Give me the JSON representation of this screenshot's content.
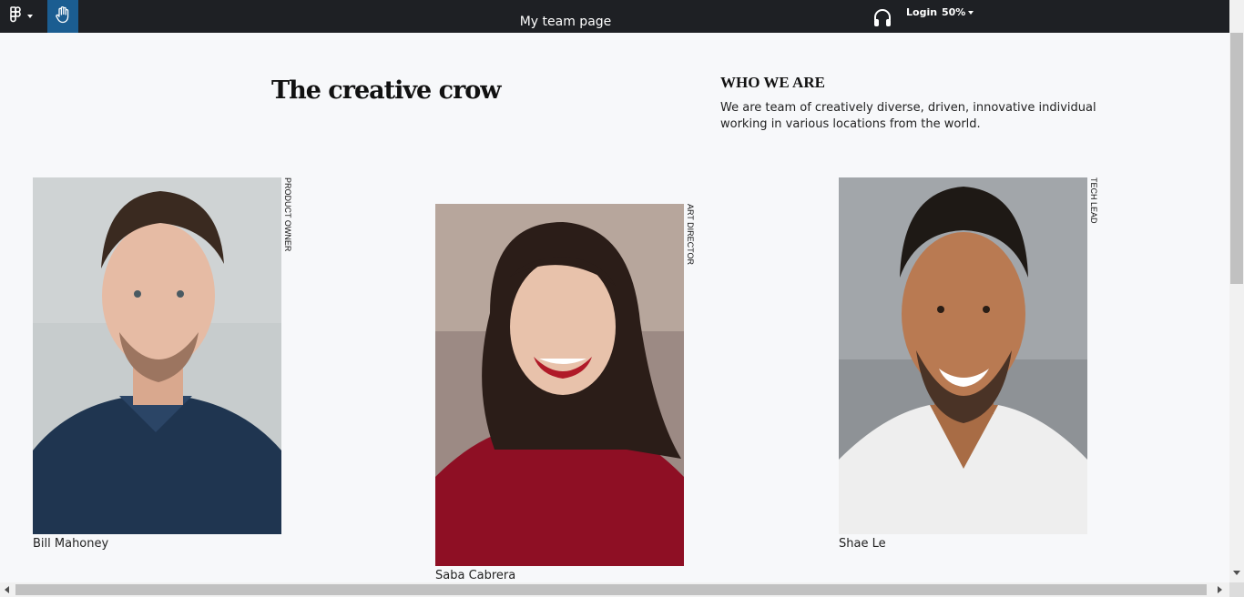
{
  "topbar": {
    "title": "My team page",
    "login_label": "Login",
    "zoom_label": "50%",
    "icons": [
      "figma-logo-icon",
      "hand-tool-icon",
      "headphones-icon"
    ],
    "accent": "#1b5d91",
    "bar_color": "#1e2024"
  },
  "hero": {
    "title": "The creative crow"
  },
  "about": {
    "heading": "WHO WE ARE",
    "text": "We are team of creatively diverse, driven, innovative individual working in various locations from the world."
  },
  "team": [
    {
      "name": "Bill Mahoney",
      "role": "PRODUCT OWNER"
    },
    {
      "name": "Saba Cabrera",
      "role": "ART DIRECTOR"
    },
    {
      "name": "Shae Le",
      "role": "TECH LEAD"
    }
  ]
}
